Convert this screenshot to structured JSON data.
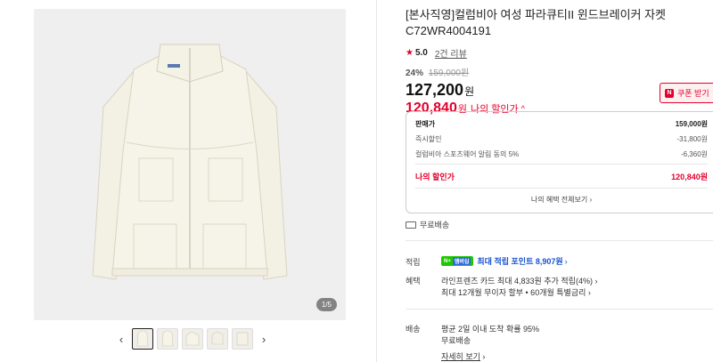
{
  "gallery": {
    "page_indicator": "1/5",
    "prev_icon": "chevron-left-icon",
    "next_icon": "chevron-right-icon",
    "thumbnail_count": 5,
    "active_index": 0
  },
  "product": {
    "title": "[본사직영]컬럼비아 여성 파라큐티II 윈드브레이커 자켓 C72WR4004191",
    "rating": "5.0",
    "reviews": "2건 리뷰",
    "discount_rate": "24%",
    "original_price": "159,000원",
    "price": "127,200",
    "price_unit": "원",
    "my_price": "120,840",
    "my_price_unit": "원",
    "my_price_label": "나의 할인가",
    "my_price_chevron": "^"
  },
  "coupon": {
    "label": "쿠폰 받기",
    "icon": "N"
  },
  "price_box": {
    "rows": [
      {
        "label": "판매가",
        "value": "159,000원"
      },
      {
        "label": "즉시할인",
        "value": "-31,800원"
      },
      {
        "label": "컬럼비아 스포츠웨어 알림 동의 5%",
        "value": "-6,360원"
      }
    ],
    "total": {
      "label": "나의 할인가",
      "value": "120,840원"
    },
    "benefit_link": "나의 혜택 전체보기"
  },
  "delivery": {
    "label": "무료배송"
  },
  "points": {
    "label": "적립",
    "badge_main": "N+",
    "badge_sub": "멤버십",
    "text": "최대 적립 포인트 8,907원"
  },
  "benefits": {
    "label": "혜택",
    "line1": "라인프렌즈 카드 최대 4,833원 추가 적립(4%)",
    "line2": "최대 12개월 무이자 할부 • 60개월 특별금리"
  },
  "shipping": {
    "label": "배송",
    "line1": "평균 2일 이내 도착 확률 95%",
    "line2": "무료배송",
    "link": "자세히 보기"
  },
  "colors": {
    "accent": "#e4002b",
    "link_blue": "#1a52d1",
    "npay_green": "#1ec800"
  }
}
